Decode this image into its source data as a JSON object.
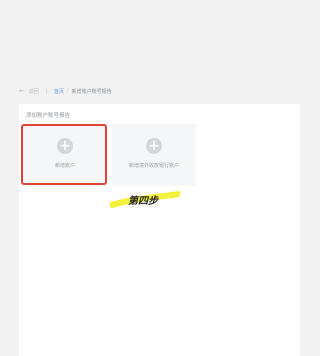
{
  "breadcrumb": {
    "back_label": "返回",
    "home_label": "首页",
    "separator": "/",
    "current_label": "新增账户账号报告"
  },
  "panel": {
    "title": "添加账户账号报告"
  },
  "cards": [
    {
      "label": "新增账户",
      "icon": "plus-circle-icon"
    },
    {
      "label": "新增境外收款银行账户",
      "icon": "plus-circle-icon"
    }
  ],
  "annotation": {
    "step_text": "第四步",
    "highlight_color": "#e0423a",
    "marker_color": "#f4f13a"
  },
  "colors": {
    "background": "#f2f2f3",
    "link": "#5c9ded"
  }
}
